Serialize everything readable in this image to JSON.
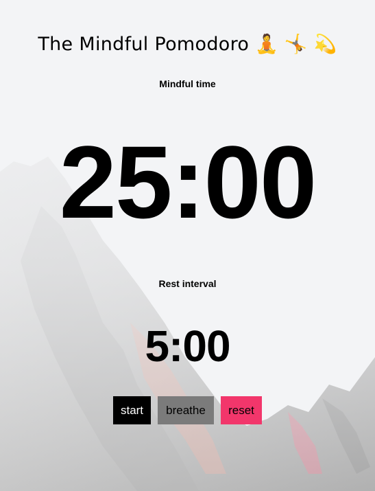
{
  "header": {
    "title": "The Mindful Pomodoro 🧘 🤸 💫"
  },
  "session": {
    "label": "Mindful time",
    "time": "25:00"
  },
  "rest": {
    "label": "Rest interval",
    "time": "5:00"
  },
  "controls": {
    "start_label": "start",
    "breathe_label": "breathe",
    "reset_label": "reset"
  },
  "colors": {
    "background": "#f3f4f6",
    "start_button": "#000000",
    "breathe_button": "#7b7b7b",
    "reset_button": "#f2366b"
  }
}
